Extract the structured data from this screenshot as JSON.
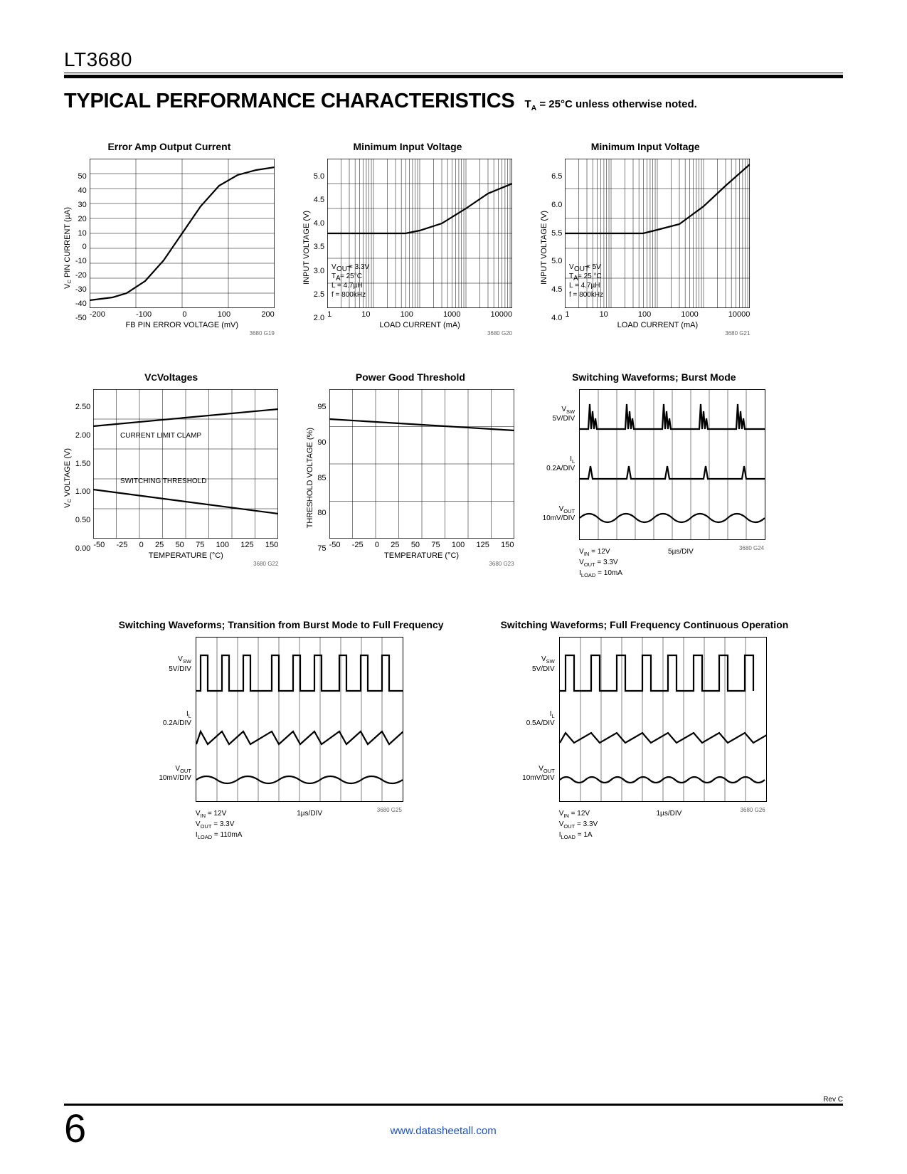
{
  "part_number": "LT3680",
  "section_title": "TYPICAL PERFORMANCE CHARACTERISTICS",
  "condition_html": "T<sub>A</sub> = 25°C unless otherwise noted.",
  "page_number": "6",
  "revision": "Rev C",
  "footer_url": "www.datasheetall.com",
  "chart_data": [
    {
      "id": "g19",
      "fig_id": "3680 G19",
      "title": "Error Amp Output Current",
      "type": "line",
      "xlabel": "FB PIN ERROR VOLTAGE (mV)",
      "ylabel_html": "V<sub>C</sub> PIN CURRENT (µA)",
      "xticks": [
        -200,
        -100,
        0,
        100,
        200
      ],
      "yticks": [
        -50,
        -40,
        -30,
        -20,
        -10,
        0,
        10,
        20,
        30,
        40,
        50
      ],
      "xlim": [
        -200,
        200
      ],
      "ylim": [
        -50,
        50
      ],
      "series": [
        {
          "name": "",
          "x": [
            -200,
            -150,
            -120,
            -80,
            -40,
            0,
            40,
            80,
            120,
            160,
            200
          ],
          "y": [
            -45,
            -43,
            -40,
            -32,
            -18,
            0,
            18,
            32,
            39,
            42,
            44
          ]
        }
      ]
    },
    {
      "id": "g20",
      "fig_id": "3680 G20",
      "title": "Minimum Input Voltage",
      "type": "line-logx",
      "xlabel": "LOAD CURRENT (mA)",
      "ylabel_html": "INPUT VOLTAGE (V)",
      "xticks": [
        1,
        10,
        100,
        1000,
        10000
      ],
      "yticks": [
        2.0,
        2.5,
        3.0,
        3.5,
        4.0,
        4.5,
        5.0
      ],
      "xlim": [
        1,
        10000
      ],
      "ylim": [
        2.0,
        5.0
      ],
      "annotations": [
        "V_OUT = 3.3V",
        "T_A = 25°C",
        "L = 4.7µH",
        "f = 800kHz"
      ],
      "series": [
        {
          "name": "",
          "x": [
            1,
            10,
            50,
            100,
            300,
            1000,
            3000,
            10000
          ],
          "y": [
            3.5,
            3.5,
            3.5,
            3.55,
            3.7,
            4.0,
            4.3,
            4.5
          ]
        }
      ]
    },
    {
      "id": "g21",
      "fig_id": "3680 G21",
      "title": "Minimum Input Voltage",
      "type": "line-logx",
      "xlabel": "LOAD CURRENT (mA)",
      "ylabel_html": "INPUT VOLTAGE (V)",
      "xticks": [
        1,
        10,
        100,
        1000,
        10000
      ],
      "yticks": [
        4.0,
        4.5,
        5.0,
        5.5,
        6.0,
        6.5
      ],
      "xlim": [
        1,
        10000
      ],
      "ylim": [
        4.0,
        6.5
      ],
      "annotations": [
        "V_OUT = 5V",
        "T_A = 25 °C",
        "L = 4.7µH",
        "f = 800kHz"
      ],
      "series": [
        {
          "name": "",
          "x": [
            1,
            10,
            50,
            100,
            300,
            1000,
            3000,
            10000
          ],
          "y": [
            5.25,
            5.25,
            5.25,
            5.3,
            5.4,
            5.7,
            6.05,
            6.4
          ]
        }
      ]
    },
    {
      "id": "g22",
      "fig_id": "3680 G22",
      "title_html": "V<sub>C</sub> Voltages",
      "type": "line",
      "xlabel": "TEMPERATURE (°C)",
      "ylabel_html": "V<sub>C</sub> VOLTAGE (V)",
      "xticks": [
        -50,
        -25,
        0,
        25,
        50,
        75,
        100,
        125,
        150
      ],
      "yticks": [
        0,
        0.5,
        1.0,
        1.5,
        2.0,
        2.5
      ],
      "xlim": [
        -50,
        150
      ],
      "ylim": [
        0,
        2.5
      ],
      "series": [
        {
          "name": "CURRENT LIMIT CLAMP",
          "x": [
            -50,
            150
          ],
          "y": [
            1.88,
            2.17
          ]
        },
        {
          "name": "SWITCHING THRESHOLD",
          "x": [
            -50,
            150
          ],
          "y": [
            0.82,
            0.42
          ]
        }
      ]
    },
    {
      "id": "g23",
      "fig_id": "3680 G23",
      "title": "Power Good Threshold",
      "type": "line",
      "xlabel": "TEMPERATURE (°C)",
      "ylabel_html": "THRESHOLD VOLTAGE (%)",
      "xticks": [
        -50,
        -25,
        0,
        25,
        50,
        75,
        100,
        125,
        150
      ],
      "yticks": [
        75,
        80,
        85,
        90,
        95
      ],
      "xlim": [
        -50,
        150
      ],
      "ylim": [
        75,
        95
      ],
      "series": [
        {
          "name": "",
          "x": [
            -50,
            150
          ],
          "y": [
            91.0,
            89.5
          ]
        }
      ]
    },
    {
      "id": "g24",
      "fig_id": "3680 G24",
      "title": "Switching Waveforms; Burst Mode",
      "type": "scope",
      "timebase": "5µs/DIV",
      "traces": [
        {
          "label_html": "V<sub>SW</sub>",
          "div": "5V/DIV"
        },
        {
          "label_html": "I<sub>L</sub>",
          "div": "0.2A/DIV"
        },
        {
          "label_html": "V<sub>OUT</sub>",
          "div": "10mV/DIV"
        }
      ],
      "conditions": [
        "V_IN = 12V",
        "V_OUT = 3.3V",
        "I_LOAD = 10mA"
      ]
    },
    {
      "id": "g25",
      "fig_id": "3680 G25",
      "title": "Switching Waveforms; Transition from Burst Mode to Full Frequency",
      "type": "scope",
      "timebase": "1µs/DIV",
      "traces": [
        {
          "label_html": "V<sub>SW</sub>",
          "div": "5V/DIV"
        },
        {
          "label_html": "I<sub>L</sub>",
          "div": "0.2A/DIV"
        },
        {
          "label_html": "V<sub>OUT</sub>",
          "div": "10mV/DIV"
        }
      ],
      "conditions": [
        "V_IN = 12V",
        "V_OUT = 3.3V",
        "I_LOAD = 110mA"
      ]
    },
    {
      "id": "g26",
      "fig_id": "3680 G26",
      "title": "Switching Waveforms; Full Frequency Continuous Operation",
      "type": "scope",
      "timebase": "1µs/DIV",
      "traces": [
        {
          "label_html": "V<sub>SW</sub>",
          "div": "5V/DIV"
        },
        {
          "label_html": "I<sub>L</sub>",
          "div": "0.5A/DIV"
        },
        {
          "label_html": "V<sub>OUT</sub>",
          "div": "10mV/DIV"
        }
      ],
      "conditions": [
        "V_IN = 12V",
        "V_OUT = 3.3V",
        "I_LOAD = 1A"
      ]
    }
  ]
}
